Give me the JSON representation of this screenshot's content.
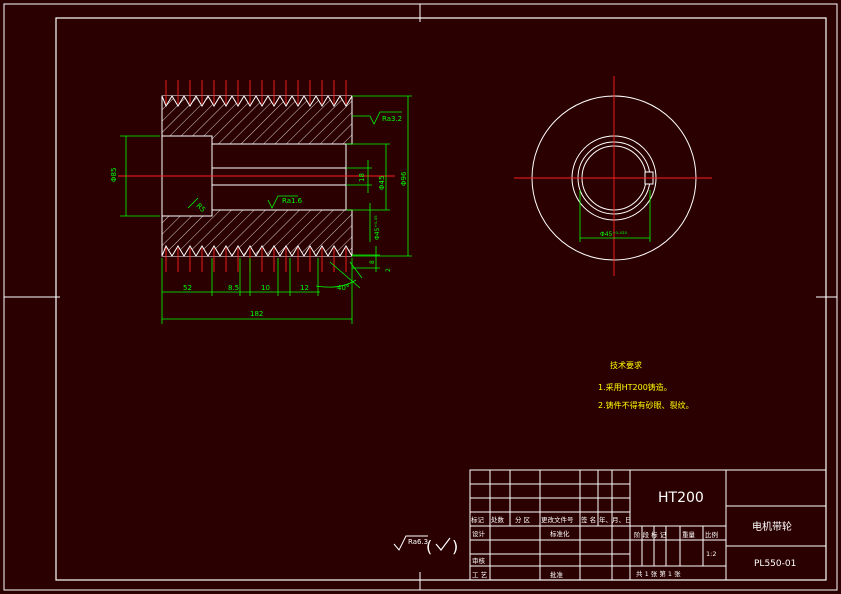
{
  "dimensions": {
    "d1": "52",
    "d2": "8.5",
    "d3": "10",
    "d4": "12",
    "total": "182",
    "left_dia": "Φ85",
    "bore_dia": "Φ45",
    "depth_18": "18",
    "outer_dia": "Φ96",
    "chamfer": "R5",
    "roughness_top": "Ra3.2",
    "roughness_mid": "Ra1.6",
    "groove_angle": "40°",
    "tolerance": "Φ45⁺⁰·⁰⁵",
    "small_8": "8",
    "small_2": "2",
    "section_dia": "Φ45⁺⁰·⁰²⁵"
  },
  "notes": {
    "title": "技术要求",
    "line1": "1.采用HT200铸造。",
    "line2": "2.铸件不得有砂眼、裂纹。"
  },
  "roughness_symbol": "Ra6.3",
  "title_block": {
    "material": "HT200",
    "part_name": "电机带轮",
    "drawing_no": "PL550-01",
    "scale": "1:2",
    "rev_headers": [
      "标记",
      "处数",
      "分 区",
      "更改文件号",
      "签 名",
      "年、月、日"
    ],
    "design": "设计",
    "standardize": "标准化",
    "review": "审核",
    "process": "工 艺",
    "approve": "批准",
    "stage_headers": [
      "阶 段 标 记",
      "重量",
      "比例"
    ],
    "sheets": "共 1 张  第 1 张"
  }
}
